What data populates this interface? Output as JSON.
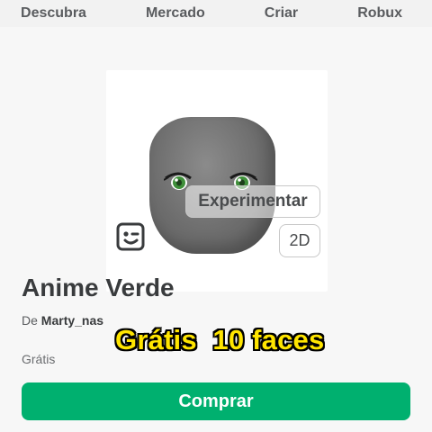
{
  "nav": {
    "items": [
      "Descubra",
      "Mercado",
      "Criar",
      "Robux"
    ]
  },
  "item": {
    "title": "Anime Verde",
    "creator_prefix": "De",
    "creator_name": "Marty_nas",
    "price": "Grátis"
  },
  "preview": {
    "try_on_label": "Experimentar",
    "view_mode_label": "2D",
    "icons": [
      "face-icon",
      "green-eyes"
    ]
  },
  "overlay_caption": "Grátis  10 faces",
  "buy_label": "Comprar",
  "colors": {
    "buy_button": "#00b06f",
    "caption": "#ffe500",
    "eye_green": "#3f8f3a"
  }
}
